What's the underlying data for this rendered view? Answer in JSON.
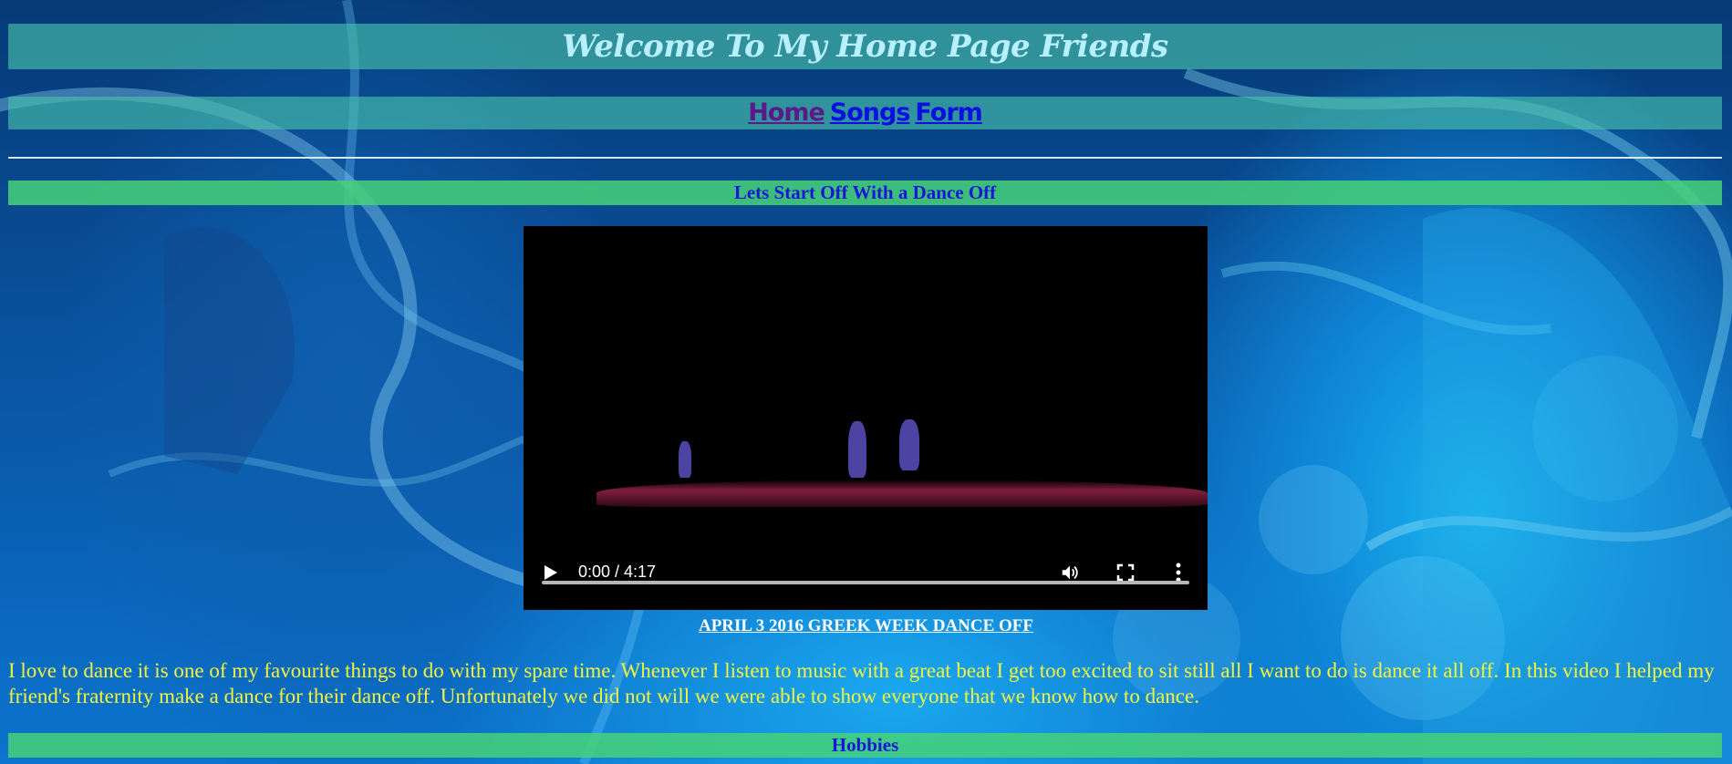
{
  "page": {
    "title": "Welcome To My Home Page Friends"
  },
  "nav": {
    "items": [
      {
        "label": "Home"
      },
      {
        "label": "Songs"
      },
      {
        "label": "Form"
      }
    ]
  },
  "sections": {
    "dance": {
      "heading": "Lets Start Off With a Dance Off",
      "video": {
        "time_display": "0:00 / 4:17",
        "progress": 0
      },
      "caption": "APRIL 3 2016 GREEK WEEK DANCE OFF",
      "paragraph": "I love to dance it is one of my favourite things to do with my spare time. Whenever I listen to music with a great beat I get too excited to sit still all I want to do is dance it all off. In this video I helped my friend's fraternity make a dance for their dance off. Unfortunately we did not will we were able to show everyone that we know how to dance."
    },
    "hobbies": {
      "heading": "Hobbies"
    }
  },
  "colors": {
    "banner": "#46beaa",
    "section_bar": "#46d278",
    "heading_text": "#1616d8",
    "paragraph_text": "#f5f53a",
    "title_text": "#b8f0ff"
  },
  "icons": {
    "play": "play-icon",
    "volume": "volume-icon",
    "fullscreen": "fullscreen-icon",
    "more": "more-vert-icon"
  }
}
